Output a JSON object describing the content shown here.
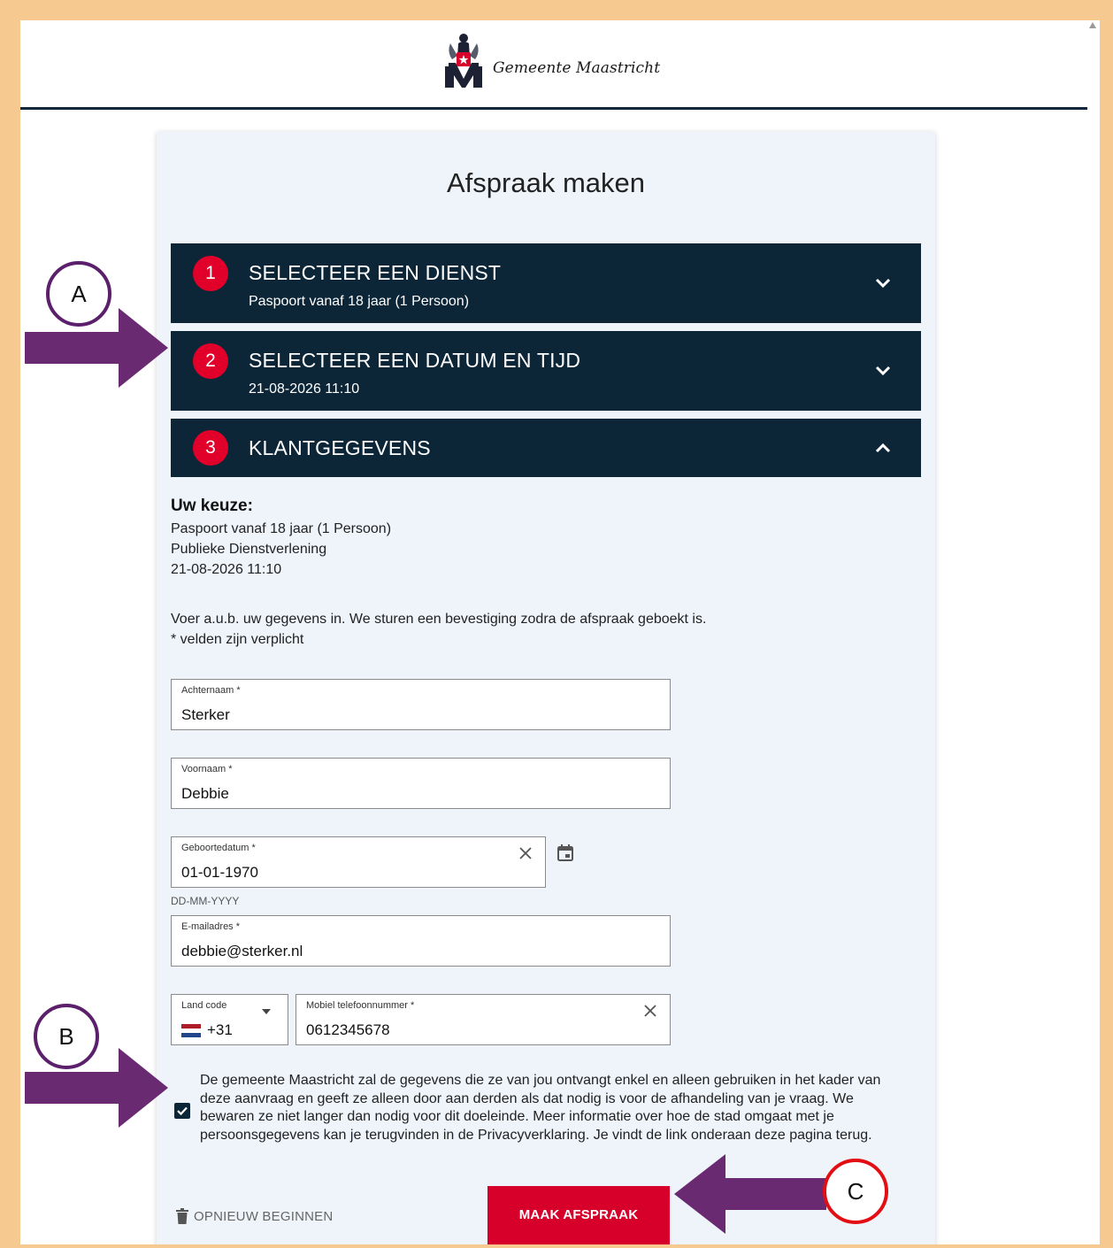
{
  "header": {
    "logo_text": "Gemeente Maastricht"
  },
  "page": {
    "title": "Afspraak maken"
  },
  "steps": [
    {
      "number": "1",
      "title": "SELECTEER EEN DIENST",
      "subtitle": "Paspoort vanaf 18 jaar (1 Persoon)",
      "state": "collapsed"
    },
    {
      "number": "2",
      "title": "SELECTEER EEN DATUM EN TIJD",
      "subtitle": "21-08-2026 11:10",
      "state": "collapsed"
    },
    {
      "number": "3",
      "title": "KLANTGEGEVENS",
      "subtitle": "",
      "state": "expanded"
    }
  ],
  "choice": {
    "heading": "Uw keuze:",
    "lines": [
      "Paspoort vanaf 18 jaar (1 Persoon)",
      "Publieke Dienstverlening",
      "21-08-2026 11:10"
    ]
  },
  "intro": {
    "line1": "Voer a.u.b. uw gegevens in. We sturen een bevestiging zodra de afspraak geboekt is.",
    "line2": "* velden zijn verplicht"
  },
  "form": {
    "last_name": {
      "label": "Achternaam *",
      "value": "Sterker"
    },
    "first_name": {
      "label": "Voornaam *",
      "value": "Debbie"
    },
    "birthdate": {
      "label": "Geboortedatum *",
      "value": "01-01-1970",
      "hint": "DD-MM-YYYY"
    },
    "email": {
      "label": "E-mailadres *",
      "value": "debbie@sterker.nl"
    },
    "country_code": {
      "label": "Land code",
      "value": "+31",
      "flag": "nl-flag-icon"
    },
    "phone": {
      "label": "Mobiel telefoonnummer *",
      "value": "0612345678"
    }
  },
  "consent": {
    "checked": true,
    "text": "De gemeente Maastricht zal de gegevens die ze van jou ontvangt enkel en alleen gebruiken in het kader van deze aanvraag en geeft ze alleen door aan derden als dat nodig is voor de afhandeling van je vraag. We bewaren ze niet langer dan nodig voor dit doeleinde. Meer informatie over hoe de stad omgaat met je persoonsgegevens kan je terugvinden in de Privacyverklaring. Je vindt de link onderaan deze pagina terug."
  },
  "actions": {
    "restart_label": "OPNIEUW BEGINNEN",
    "submit_label": "MAAK AFSPRAAK"
  },
  "annotations": {
    "a": "A",
    "b": "B",
    "c": "C"
  },
  "colors": {
    "navy": "#0c2638",
    "red": "#d6002a",
    "annotation_purple": "#6a2a72",
    "annotation_red": "#e30d14",
    "frame": "#f5c98f"
  }
}
